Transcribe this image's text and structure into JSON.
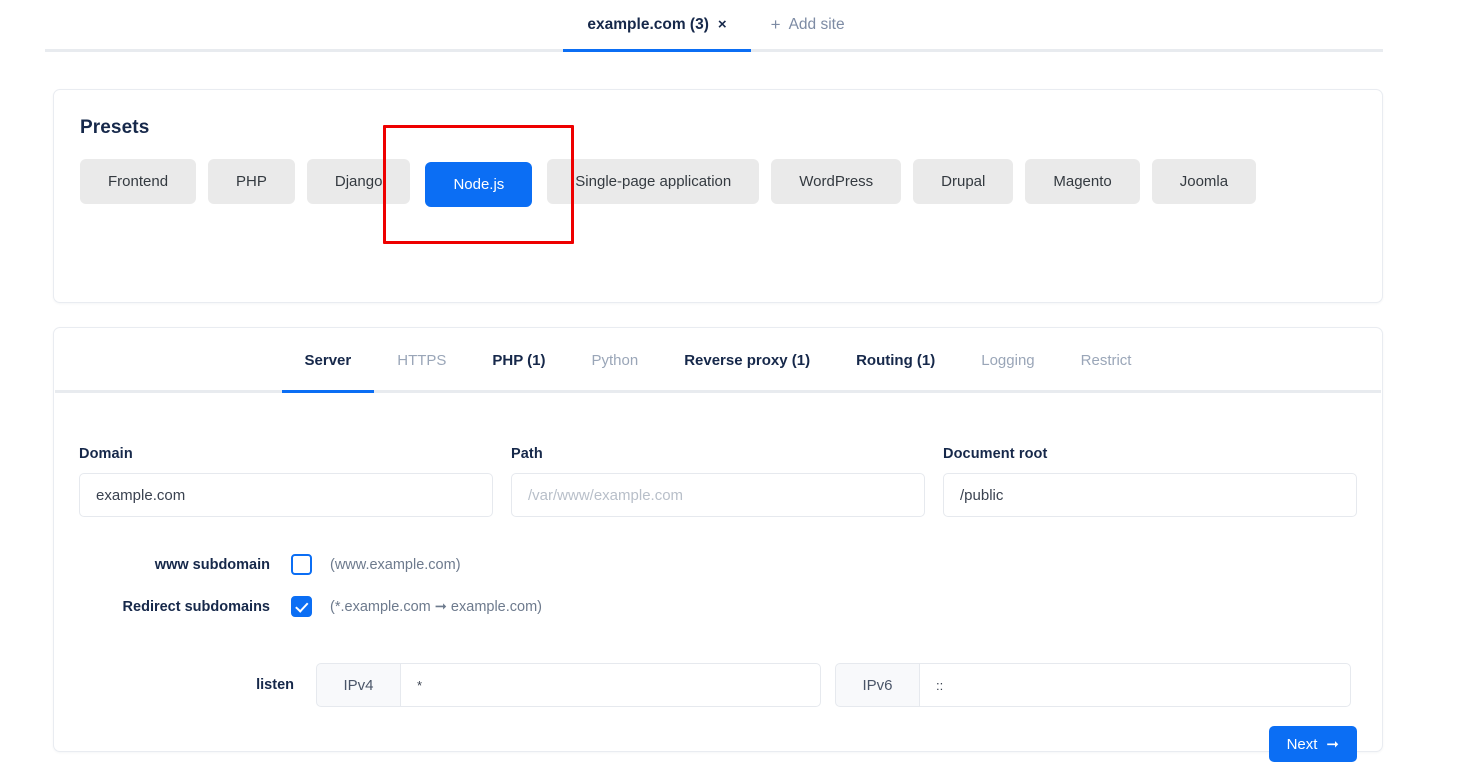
{
  "site_tabs": {
    "tab_label": "example.com (3)",
    "close_icon": "×",
    "add_plus": "+",
    "add_label": "Add site"
  },
  "presets": {
    "title": "Presets",
    "selected": "Node.js",
    "highlighted": "Node.js",
    "items": [
      {
        "label": "Frontend"
      },
      {
        "label": "PHP"
      },
      {
        "label": "Django"
      },
      {
        "label": "Node.js"
      },
      {
        "label": "Single-page application"
      },
      {
        "label": "WordPress"
      },
      {
        "label": "Drupal"
      },
      {
        "label": "Magento"
      },
      {
        "label": "Joomla"
      }
    ],
    "highlight_color": "#ee0000",
    "accent_color": "#0b6ef4"
  },
  "settings": {
    "tabs": [
      {
        "label": "Server",
        "state": "active"
      },
      {
        "label": "HTTPS",
        "state": "muted"
      },
      {
        "label": "PHP (1)",
        "state": "normal"
      },
      {
        "label": "Python",
        "state": "muted"
      },
      {
        "label": "Reverse proxy (1)",
        "state": "normal"
      },
      {
        "label": "Routing (1)",
        "state": "normal"
      },
      {
        "label": "Logging",
        "state": "muted"
      },
      {
        "label": "Restrict",
        "state": "muted"
      }
    ],
    "fields": {
      "domain": {
        "label": "Domain",
        "value": "example.com",
        "placeholder": "example.com"
      },
      "path": {
        "label": "Path",
        "value": "",
        "placeholder": "/var/www/example.com"
      },
      "document_root": {
        "label": "Document root",
        "value": "/public",
        "placeholder": "/public"
      }
    },
    "www_subdomain": {
      "label": "www subdomain",
      "hint": "(www.example.com)",
      "checked": false
    },
    "redirect_subdomains": {
      "label": "Redirect subdomains",
      "hint": "(*.example.com ➞ example.com)",
      "checked": true
    },
    "listen": {
      "label": "listen",
      "ipv4": {
        "addon": "IPv4",
        "value": "*"
      },
      "ipv6": {
        "addon": "IPv6",
        "value": "::"
      }
    },
    "next_button": {
      "label": "Next",
      "arrow": "➞"
    }
  }
}
